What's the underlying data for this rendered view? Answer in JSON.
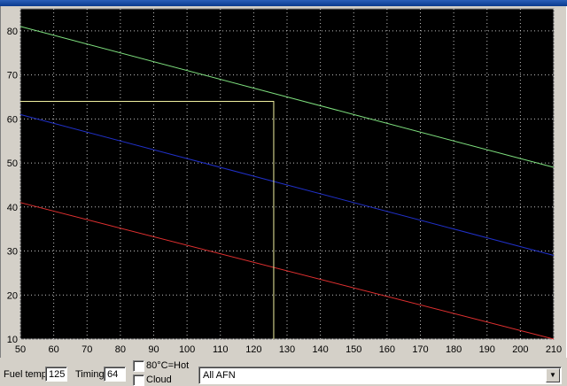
{
  "chart_data": {
    "type": "line",
    "xlim": [
      50,
      210
    ],
    "ylim": [
      10,
      85
    ],
    "x_ticks": [
      50,
      60,
      70,
      80,
      90,
      100,
      110,
      120,
      130,
      140,
      150,
      160,
      170,
      180,
      190,
      200,
      210
    ],
    "y_ticks": [
      10,
      20,
      30,
      40,
      50,
      60,
      70,
      80
    ],
    "x_tick_labels": [
      "50",
      "60",
      "70",
      "80",
      "90",
      "100",
      "110",
      "120",
      "130",
      "140",
      "150",
      "160",
      "170",
      "180",
      "190",
      "200",
      "210"
    ],
    "y_tick_labels": [
      "10",
      "20",
      "30",
      "40",
      "50",
      "60",
      "70",
      "80"
    ],
    "grid": true,
    "background": "#000000",
    "series": [
      {
        "color": "#7ee07e",
        "x": [
          50,
          210
        ],
        "y": [
          81,
          49
        ]
      },
      {
        "color": "#2030c8",
        "x": [
          50,
          210
        ],
        "y": [
          61,
          29
        ]
      },
      {
        "color": "#e03030",
        "x": [
          50,
          210
        ],
        "y": [
          41,
          10
        ]
      }
    ],
    "crosshair": {
      "color": "#f0f0a0",
      "x": 126,
      "y": 64
    }
  },
  "controls": {
    "fuel_temp_label": "Fuel temp",
    "fuel_temp_value": "125",
    "timing_label": "Timing",
    "timing_value": "64",
    "hot_label": "80°C=Hot",
    "cloud_label": "Cloud",
    "afn_select_value": "All AFN"
  }
}
